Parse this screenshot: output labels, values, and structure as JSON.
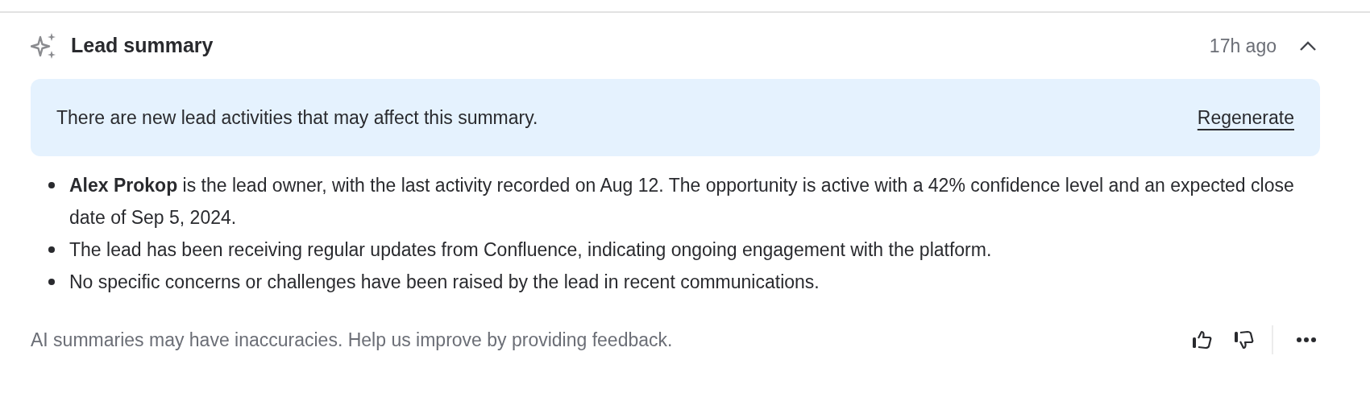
{
  "header": {
    "title": "Lead summary",
    "time": "17h ago",
    "expanded": true
  },
  "notice": {
    "message": "There are new lead activities that may affect this summary.",
    "action": "Regenerate"
  },
  "bullets": [
    "**Alex Prokop** is the lead owner, with the last activity recorded on Aug 12. The opportunity is active with a 42% confidence level and an expected close date of Sep 5, 2024.",
    "The lead has been receiving regular updates from Confluence, indicating ongoing engagement with the platform.",
    "No specific concerns or challenges have been raised by the lead in recent communications."
  ],
  "footer": {
    "disclaimer": "AI summaries may have inaccuracies. Help us improve by providing feedback."
  }
}
